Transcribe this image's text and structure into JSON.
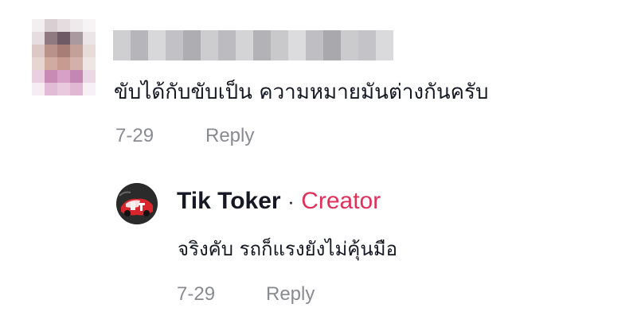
{
  "comment": {
    "username": "",
    "text": "ขับได้กับขับเป็น ความหมายมันต่างกันครับ",
    "date": "7-29",
    "reply_label": "Reply",
    "avatar_icon": "blurred-avatar-icon"
  },
  "reply": {
    "author": "Tik Toker",
    "separator": "·",
    "badge": "Creator",
    "text": "จริงคับ รถก็แรงยังไม่คุ้นมือ",
    "date": "7-29",
    "reply_label": "Reply",
    "avatar_icon": "creator-avatar-icon"
  },
  "colors": {
    "text_primary": "#161823",
    "text_secondary": "#8a8b91",
    "creator_accent": "#e0315b",
    "background": "#ffffff"
  }
}
